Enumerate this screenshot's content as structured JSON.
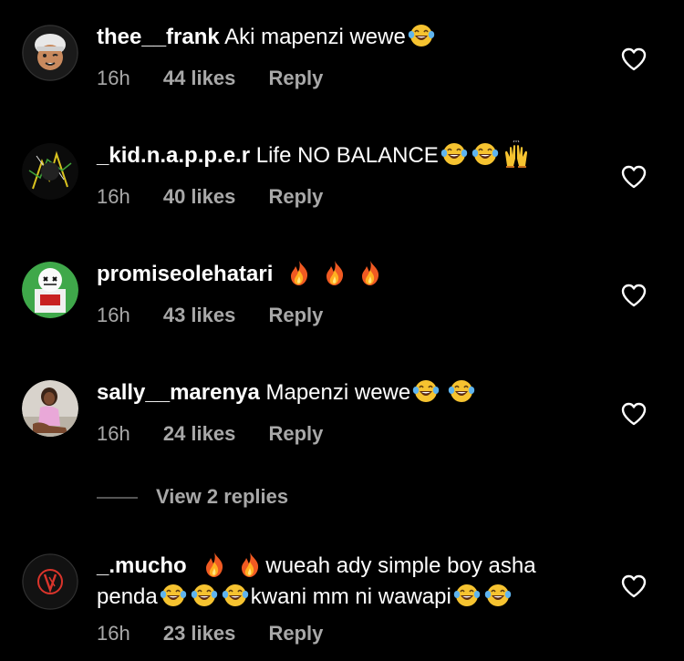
{
  "comments": [
    {
      "username": "thee__frank",
      "text": "Aki mapenzi wewe",
      "emojis": [
        "laughing-tears"
      ],
      "time": "16h",
      "likes": "44 likes",
      "reply": "Reply"
    },
    {
      "username": "_kid.n.a.p.p.e.r",
      "text": "Life NO BALANCE",
      "emojis": [
        "laughing-tears",
        "laughing-tears",
        "raising-hands"
      ],
      "time": "16h",
      "likes": "40 likes",
      "reply": "Reply"
    },
    {
      "username": "promiseolehatari",
      "text": "",
      "emojis": [
        "fire",
        "fire",
        "fire"
      ],
      "time": "16h",
      "likes": "43 likes",
      "reply": "Reply"
    },
    {
      "username": "sally__marenya",
      "text": "Mapenzi wewe",
      "emojis": [
        "laughing-tears",
        "laughing-tears"
      ],
      "time": "16h",
      "likes": "24 likes",
      "reply": "Reply"
    },
    {
      "username": "_.mucho",
      "text_part1": "wueah ady simple boy asha",
      "text_part2": "penda",
      "text_part3": "kwani mm ni wawapi",
      "time": "16h",
      "likes": "23 likes",
      "reply": "Reply"
    }
  ],
  "view_replies": "View 2 replies",
  "colors": {
    "background": "#000000",
    "text": "#ffffff",
    "meta": "#a8a8a8"
  }
}
